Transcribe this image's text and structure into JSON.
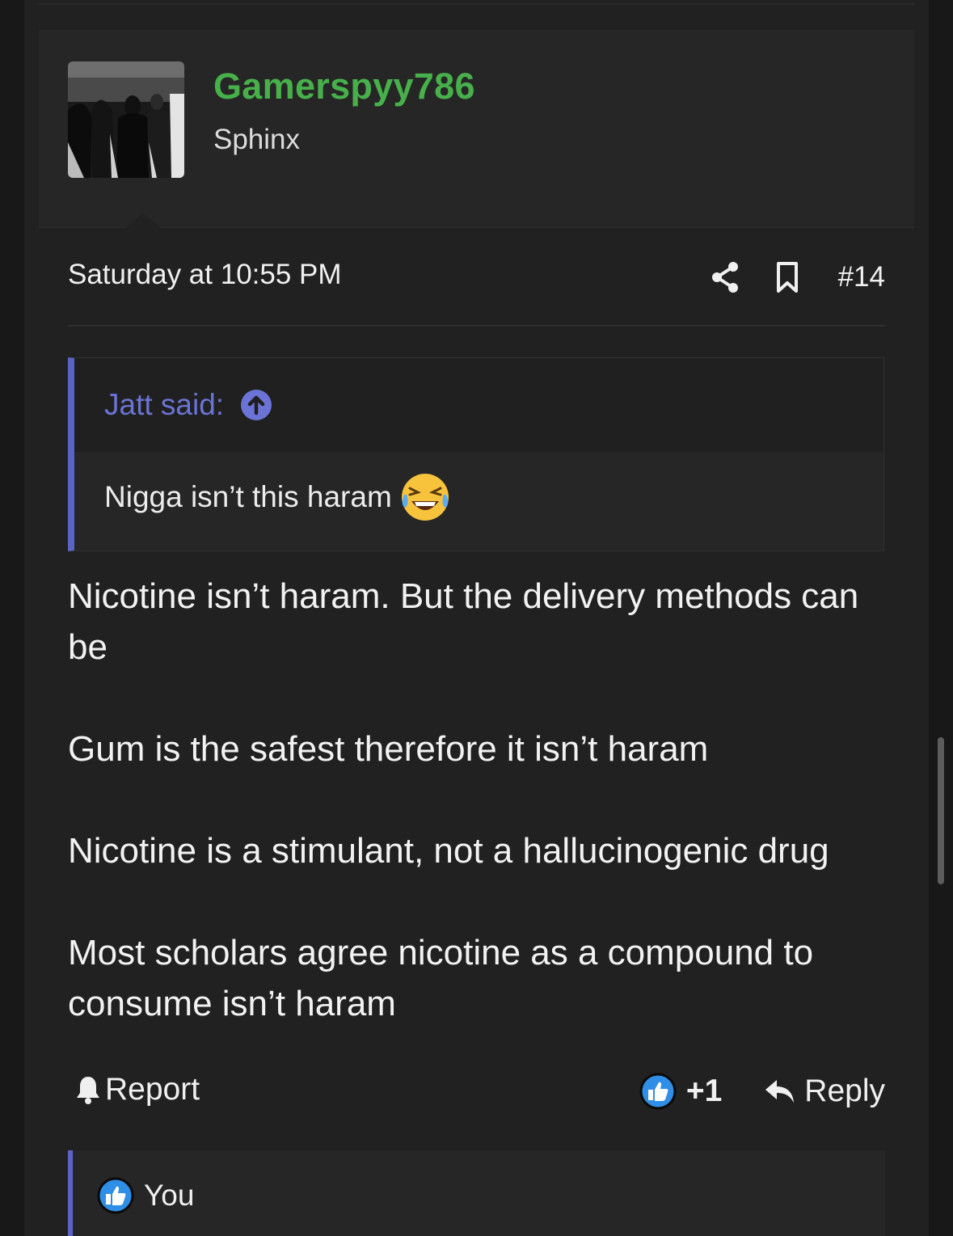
{
  "user": {
    "name": "Gamerspyy786",
    "title": "Sphinx",
    "name_color": "#47b04b",
    "avatar_icon": "avatar-photo"
  },
  "meta": {
    "date": "Saturday at 10:55 PM",
    "post_number": "#14",
    "share_icon": "share-icon",
    "bookmark_icon": "bookmark-icon"
  },
  "quote": {
    "author": "Jatt said:",
    "body": "Nigga isn’t this haram",
    "emoji": "laughing-crying-emoji",
    "accent": "#5a63c6"
  },
  "content": {
    "paragraphs": [
      "Nicotine isn’t haram. But the delivery methods can be",
      "Gum is the safest therefore it isn’t haram",
      "Nicotine is a stimulant, not a hallucinogenic drug",
      "Most scholars agree nicotine as a compound to consume isn’t haram"
    ]
  },
  "footer": {
    "report_label": "Report",
    "like_count": "+1",
    "reply_label": "Reply"
  },
  "reactions": {
    "label": "You",
    "like_color": "#2f8ee5"
  }
}
